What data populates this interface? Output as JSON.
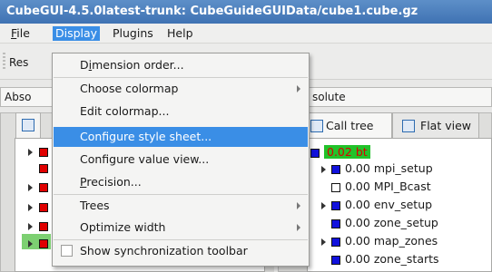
{
  "window": {
    "title": "CubeGUI-4.5.0latest-trunk: CubeGuideGUIData/cube1.cube.gz"
  },
  "menubar": {
    "file": "File",
    "display": "Display",
    "plugins": "Plugins",
    "help": "Help"
  },
  "toolbar": {
    "button_partial": "Res"
  },
  "left_combo": {
    "value": "Abso"
  },
  "right_combo": {
    "value": "solute"
  },
  "tabs": {
    "call_tree": "Call tree",
    "flat_view": "Flat view"
  },
  "call_tree": {
    "root": {
      "value": "0.02",
      "label": "bt"
    },
    "rows": [
      {
        "value": "0.00",
        "label": "mpi_setup",
        "icon": "blue-square",
        "expandable": true
      },
      {
        "value": "0.00",
        "label": "MPI_Bcast",
        "icon": "white-square",
        "expandable": false
      },
      {
        "value": "0.00",
        "label": "env_setup",
        "icon": "blue-square",
        "expandable": true
      },
      {
        "value": "0.00",
        "label": "zone_setup",
        "icon": "blue-square",
        "expandable": false
      },
      {
        "value": "0.00",
        "label": "map_zones",
        "icon": "blue-square",
        "expandable": true
      },
      {
        "value": "0.00",
        "label": "zone_starts",
        "icon": "blue-square",
        "expandable": false
      }
    ]
  },
  "display_menu": {
    "items": [
      {
        "label_pre": "D",
        "label_ul": "i",
        "label_post": "mension order...",
        "submenu": false
      },
      {
        "label": "Choose colormap",
        "submenu": true
      },
      {
        "label": "Edit colormap...",
        "submenu": false
      },
      {
        "label": "Configure style sheet...",
        "submenu": false,
        "selected": true
      },
      {
        "label": "Configure value view...",
        "submenu": false
      },
      {
        "label_pre": "",
        "label_ul": "P",
        "label_post": "recision...",
        "submenu": false
      },
      {
        "label": "Trees",
        "submenu": true
      },
      {
        "label": "Optimize width",
        "submenu": true
      },
      {
        "label": "Show synchronization toolbar",
        "checkbox": true,
        "checked": false
      }
    ]
  },
  "colors": {
    "accent": "#3a8ee6",
    "titlebar": "#3f72b3",
    "severity_red": "#e00000",
    "severity_blue": "#1111dd",
    "highlight_green": "#22c22a"
  }
}
